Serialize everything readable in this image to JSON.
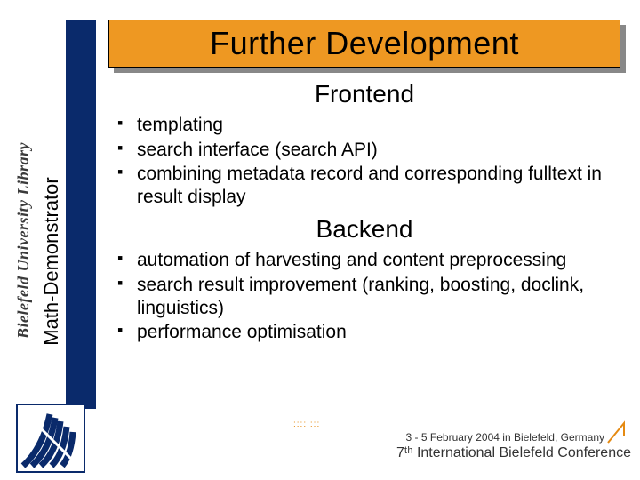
{
  "title": "Further Development",
  "sideLabel": "Math-Demonstrator",
  "libraryLabel": "Bielefeld University Library",
  "sections": {
    "frontend": {
      "heading": "Frontend",
      "items": [
        "templating",
        "search interface (search API)",
        "combining metadata record and corresponding fulltext in result display"
      ]
    },
    "backend": {
      "heading": "Backend",
      "items": [
        "automation of harvesting and content preprocessing",
        "search result improvement (ranking, boosting, doclink, linguistics)",
        "performance optimisation"
      ]
    }
  },
  "footer": {
    "dates": "3 - 5 February 2004 in Bielefeld, Germany",
    "conference": "7ᵗʰ International Bielefeld Conference"
  }
}
